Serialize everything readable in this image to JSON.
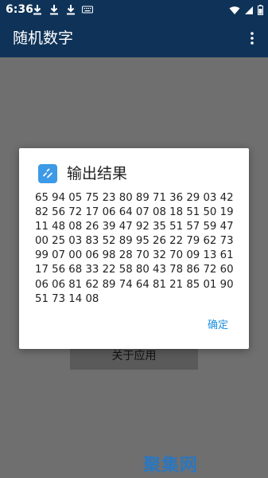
{
  "status_bar": {
    "time": "6:36",
    "icons_left": [
      "download-icon",
      "download-icon",
      "download-icon",
      "keyboard-icon"
    ],
    "icons_right": [
      "wifi-icon",
      "signal-icon",
      "battery-icon"
    ]
  },
  "app_bar": {
    "title": "随机数字",
    "menu_icon": "more-vert-icon"
  },
  "background": {
    "button_label": "关于应用",
    "watermark": "聚集网"
  },
  "dialog": {
    "icon": "shuffle-icon",
    "title": "输出结果",
    "body": "65 94 05 75 23 80 89 71 36 29 03 42\n82 56 72 17 06 64 07 08 18 51 50 19\n11 48 08 26 39 47 92 35 51 57 59 47\n00 25 03 83 52 89 95 26 22 79 62 73\n99 07 00 06 98 28 70 32 70 09 13 61\n17 56 68 33 22 58 80 43 78 86 72 60\n06 06 81 62 89 74 64 81 21 85 01 90\n51 73 14 08",
    "ok_label": "确定"
  },
  "colors": {
    "app_bar": "#0f3358",
    "scrim": "#6f6f6f",
    "accent": "#1d8fe0",
    "dialog_icon": "#3c9ae6"
  }
}
